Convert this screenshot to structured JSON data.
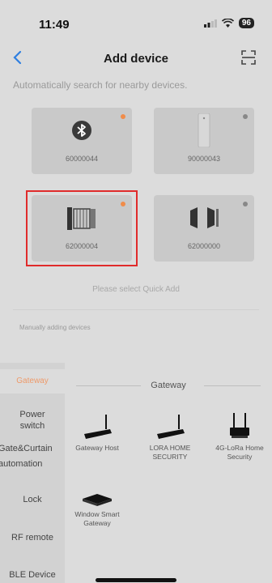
{
  "status_bar": {
    "time": "11:49",
    "battery": "96"
  },
  "header": {
    "title": "Add device"
  },
  "auto_search_hint": "Automatically search for nearby devices.",
  "nearby_devices": [
    {
      "id": "60000044",
      "icon": "bluetooth-icon",
      "status_color": "#f08c4a"
    },
    {
      "id": "90000043",
      "icon": "sensor-icon",
      "status_color": "#888888"
    },
    {
      "id": "62000004",
      "icon": "gate-icon",
      "status_color": "#f08c4a",
      "selected": true
    },
    {
      "id": "62000000",
      "icon": "folding-door-icon",
      "status_color": "#888888"
    }
  ],
  "quick_add_hint": "Please select Quick Add",
  "manual_label": "Manually adding devices",
  "categories": [
    {
      "label": "Gateway",
      "active": true
    },
    {
      "label": "Power switch"
    },
    {
      "label": "Gate&Curtain automation"
    },
    {
      "label": "Lock"
    },
    {
      "label": "RF remote"
    },
    {
      "label": "BLE Device"
    }
  ],
  "section_title": "Gateway",
  "products": [
    {
      "label": "Gateway Host",
      "icon": "router-icon"
    },
    {
      "label": "LORA HOME SECURITY",
      "icon": "router-icon"
    },
    {
      "label": "4G-LoRa Home Security",
      "icon": "router-4g-icon"
    },
    {
      "label": "Window Smart Gateway",
      "icon": "smart-gateway-icon"
    }
  ]
}
